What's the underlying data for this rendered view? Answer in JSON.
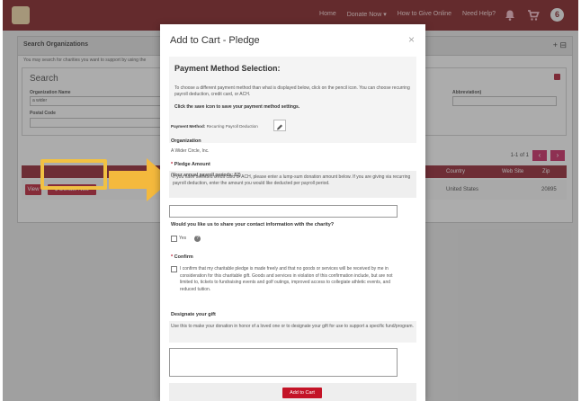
{
  "header": {
    "nav": [
      "Home",
      "Donate Now ▾",
      "How to Give Online",
      "Need Help?"
    ],
    "avatar_letter": "6",
    "brand_color": "#7c1418"
  },
  "page": {
    "title": "Search Organizations",
    "hint": "You may search for charities you want to support by using the",
    "search_title": "Search",
    "org_name_label": "Organization Name",
    "org_name_value": "a wider",
    "postal_label": "Postal Code",
    "abbrev_label": "Abbreviation)",
    "pager_text": "1-1 of 1",
    "table_headers": [
      "Country",
      "Web Site",
      "Zip"
    ],
    "row": {
      "country": "United States",
      "zip": "20895"
    },
    "view_label": "View",
    "donate_label": "$ Donate Now"
  },
  "modal": {
    "title": "Add to Cart - Pledge",
    "close": "×",
    "pm_title": "Payment Method Selection:",
    "pm_text": "To choose a different payment method than what is displayed below, click on the pencil icon. You can choose recurring payroll deduction, credit card, or ACH.",
    "pm_save": "Click the save icon to save your payment method settings.",
    "pm_method_label": "Payment Method:",
    "pm_method_value": "Recurring Payroll Deduction",
    "org_label": "Organization",
    "org_value": "A Wider Circle, Inc.",
    "pledge_label": "Pledge Amount",
    "pledge_note": "If you have selected credit card or ACH, please enter a lump-sum donation amount below. If you are giving via recurring payroll deduction, enter the amount you would like deducted per payroll period.",
    "pledge_note_bold": "(Your annual payroll periods: 52)",
    "share_label": "Would you like us to share your contact information with the charity?",
    "yes_label": "Yes",
    "confirm_label": "Confirm",
    "confirm_text": "I confirm that my charitable pledge is made freely and that no goods or services will be received by me in consideration for this charitable gift. Goods and services in violation of this confirmation include, but are not limited to, tickets to fundraising events and golf outings, improved access to collegiate athletic events, and reduced tuition.",
    "gift_label": "Designate your gift",
    "gift_note": "Use this to make your donation in honor of a loved one or to designate your gift for use to support a specific fund/program.",
    "add_button": "Add to Cart"
  },
  "icons": {
    "logo": "logo-icon",
    "bell": "bell-icon",
    "cart": "cart-icon",
    "pencil": "pencil-icon",
    "help": "help-icon",
    "close": "close-icon",
    "callout": "arrow-icon"
  },
  "colors": {
    "accent_red": "#b9152d",
    "highlight_yellow": "#f1c143"
  }
}
